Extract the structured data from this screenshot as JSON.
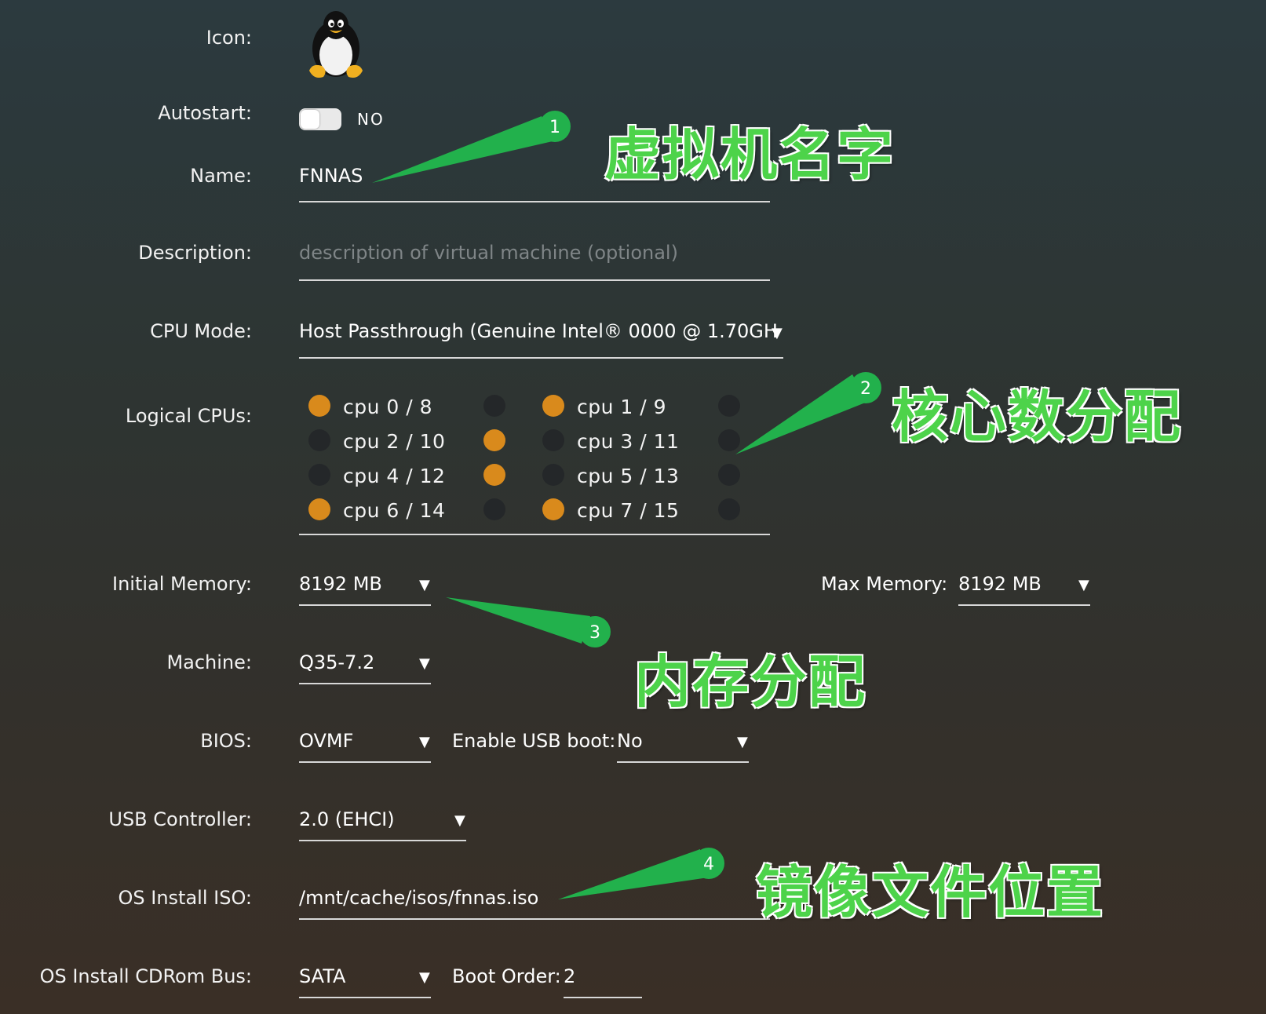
{
  "labels": {
    "icon": "Icon:",
    "autostart": "Autostart:",
    "name": "Name:",
    "description": "Description:",
    "cpu_mode": "CPU Mode:",
    "logical_cpus": "Logical CPUs:",
    "initial_memory": "Initial Memory:",
    "max_memory": "Max Memory:",
    "machine": "Machine:",
    "bios": "BIOS:",
    "enable_usb_boot": "Enable USB boot:",
    "usb_controller": "USB Controller:",
    "os_install_iso": "OS Install ISO:",
    "os_install_cdrom_bus": "OS Install CDRom Bus:",
    "boot_order": "Boot Order:"
  },
  "icon": {
    "name": "tux-penguin-icon"
  },
  "autostart": {
    "state": "NO",
    "on": false
  },
  "name": {
    "value": "FNNAS"
  },
  "description": {
    "placeholder": "description of virtual machine (optional)",
    "value": ""
  },
  "cpu_mode": {
    "value": "Host Passthrough (Genuine Intel® 0000 @ 1.70GH"
  },
  "logical_cpus": [
    {
      "label": "cpu 0 / 8",
      "first": true,
      "second": false
    },
    {
      "label": "cpu 1 / 9",
      "first": true,
      "second": false
    },
    {
      "label": "cpu 2 / 10",
      "first": false,
      "second": true
    },
    {
      "label": "cpu 3 / 11",
      "first": false,
      "second": false
    },
    {
      "label": "cpu 4 / 12",
      "first": false,
      "second": true
    },
    {
      "label": "cpu 5 / 13",
      "first": false,
      "second": false
    },
    {
      "label": "cpu 6 / 14",
      "first": true,
      "second": false
    },
    {
      "label": "cpu 7 / 15",
      "first": true,
      "second": false
    }
  ],
  "initial_memory": {
    "value": "8192 MB"
  },
  "max_memory": {
    "value": "8192 MB"
  },
  "machine": {
    "value": "Q35-7.2"
  },
  "bios": {
    "value": "OVMF"
  },
  "enable_usb_boot": {
    "value": "No"
  },
  "usb_controller": {
    "value": "2.0 (EHCI)"
  },
  "os_install_iso": {
    "value": "/mnt/cache/isos/fnnas.iso"
  },
  "os_install_cdrom_bus": {
    "value": "SATA"
  },
  "boot_order": {
    "value": "2"
  },
  "dropdown_arrow": "▼",
  "annotations": [
    {
      "number": "1",
      "text": "虚拟机名字"
    },
    {
      "number": "2",
      "text": "核心数分配"
    },
    {
      "number": "3",
      "text": "内存分配"
    },
    {
      "number": "4",
      "text": "镜像文件位置"
    }
  ],
  "colors": {
    "selected_core": "#d98a1c",
    "unselected_core": "#242729",
    "annotation_green": "#4dd34a",
    "callout_green": "#22b14c"
  }
}
